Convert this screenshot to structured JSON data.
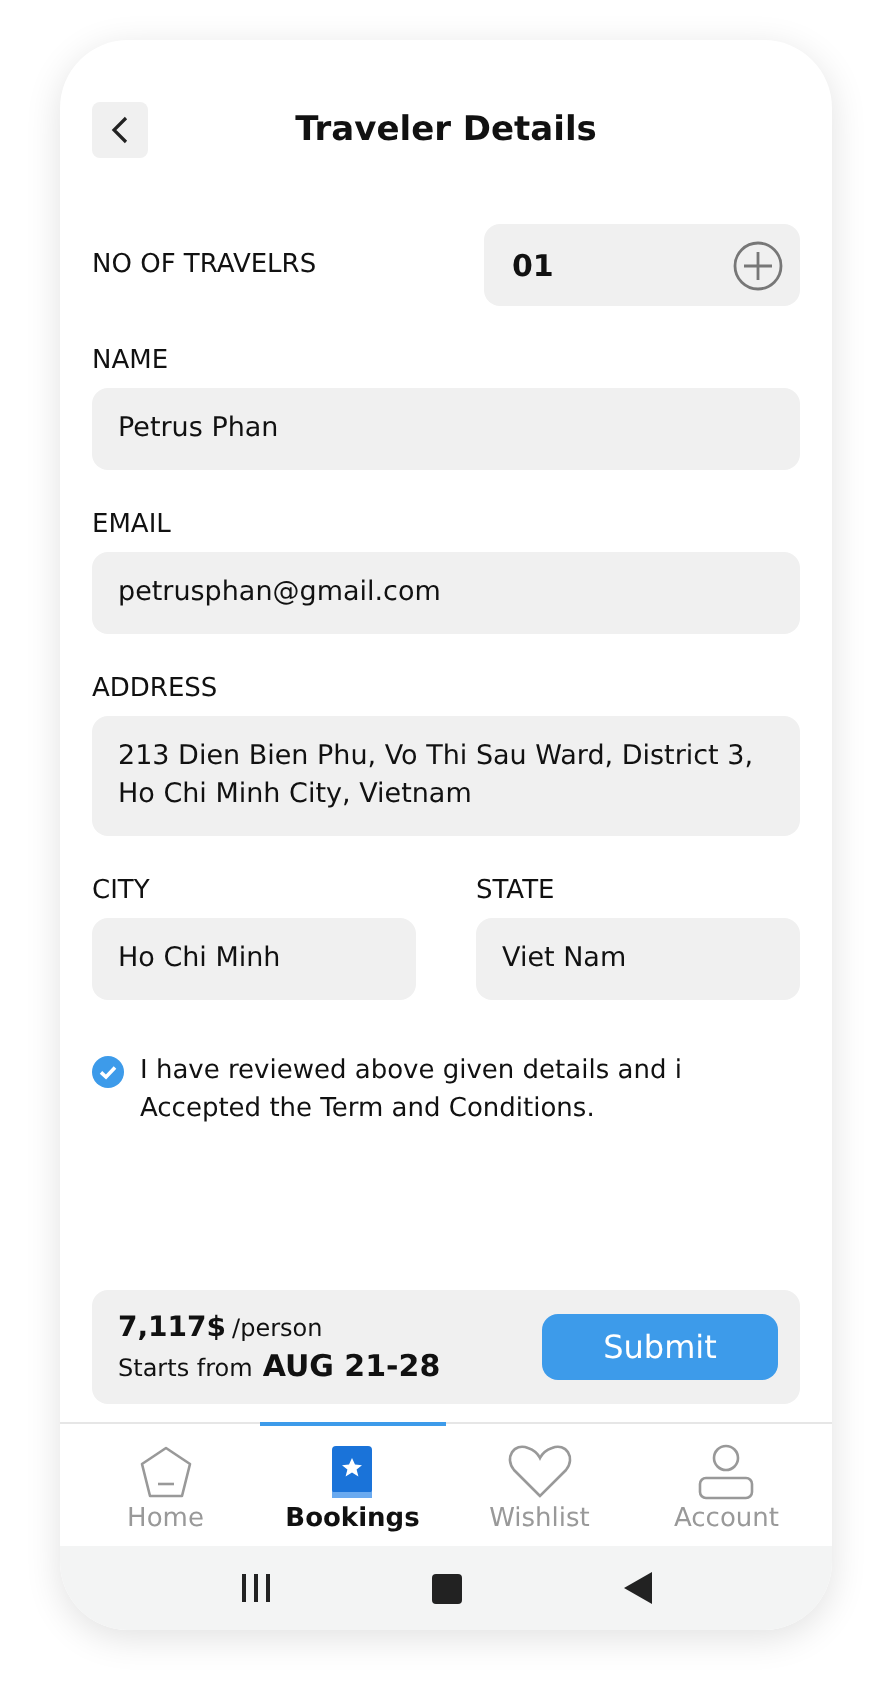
{
  "header": {
    "title": "Traveler Details"
  },
  "travelers": {
    "label": "NO OF TRAVELRS",
    "value": "01"
  },
  "fields": [
    {
      "label": "NAME",
      "value": "Petrus Phan",
      "kind": "full"
    },
    {
      "label": "EMAIL",
      "value": "petrusphan@gmail.com",
      "kind": "full"
    },
    {
      "label": "ADDRESS",
      "value": "213 Dien Bien Phu, Vo Thi Sau Ward, District 3, Ho Chi Minh City, Vietnam",
      "kind": "full"
    },
    {
      "label": "CITY",
      "value": "Ho Chi Minh",
      "kind": "half"
    },
    {
      "label": "STATE",
      "value": "Viet Nam",
      "kind": "half"
    }
  ],
  "agreement": {
    "checked": true,
    "text": "I have reviewed above given details and i Accepted the Term and Conditions."
  },
  "summary": {
    "price": "7,117$",
    "unit": "/person",
    "starts_label": "Starts from",
    "dates": "AUG 21-28",
    "button": "Submit"
  },
  "nav": [
    {
      "label": "Home",
      "kind": "home",
      "selected": false
    },
    {
      "label": "Bookings",
      "kind": "bookings",
      "selected": true
    },
    {
      "label": "Wishlist",
      "kind": "wishlist",
      "selected": false
    },
    {
      "label": "Account",
      "kind": "account",
      "selected": false
    }
  ]
}
